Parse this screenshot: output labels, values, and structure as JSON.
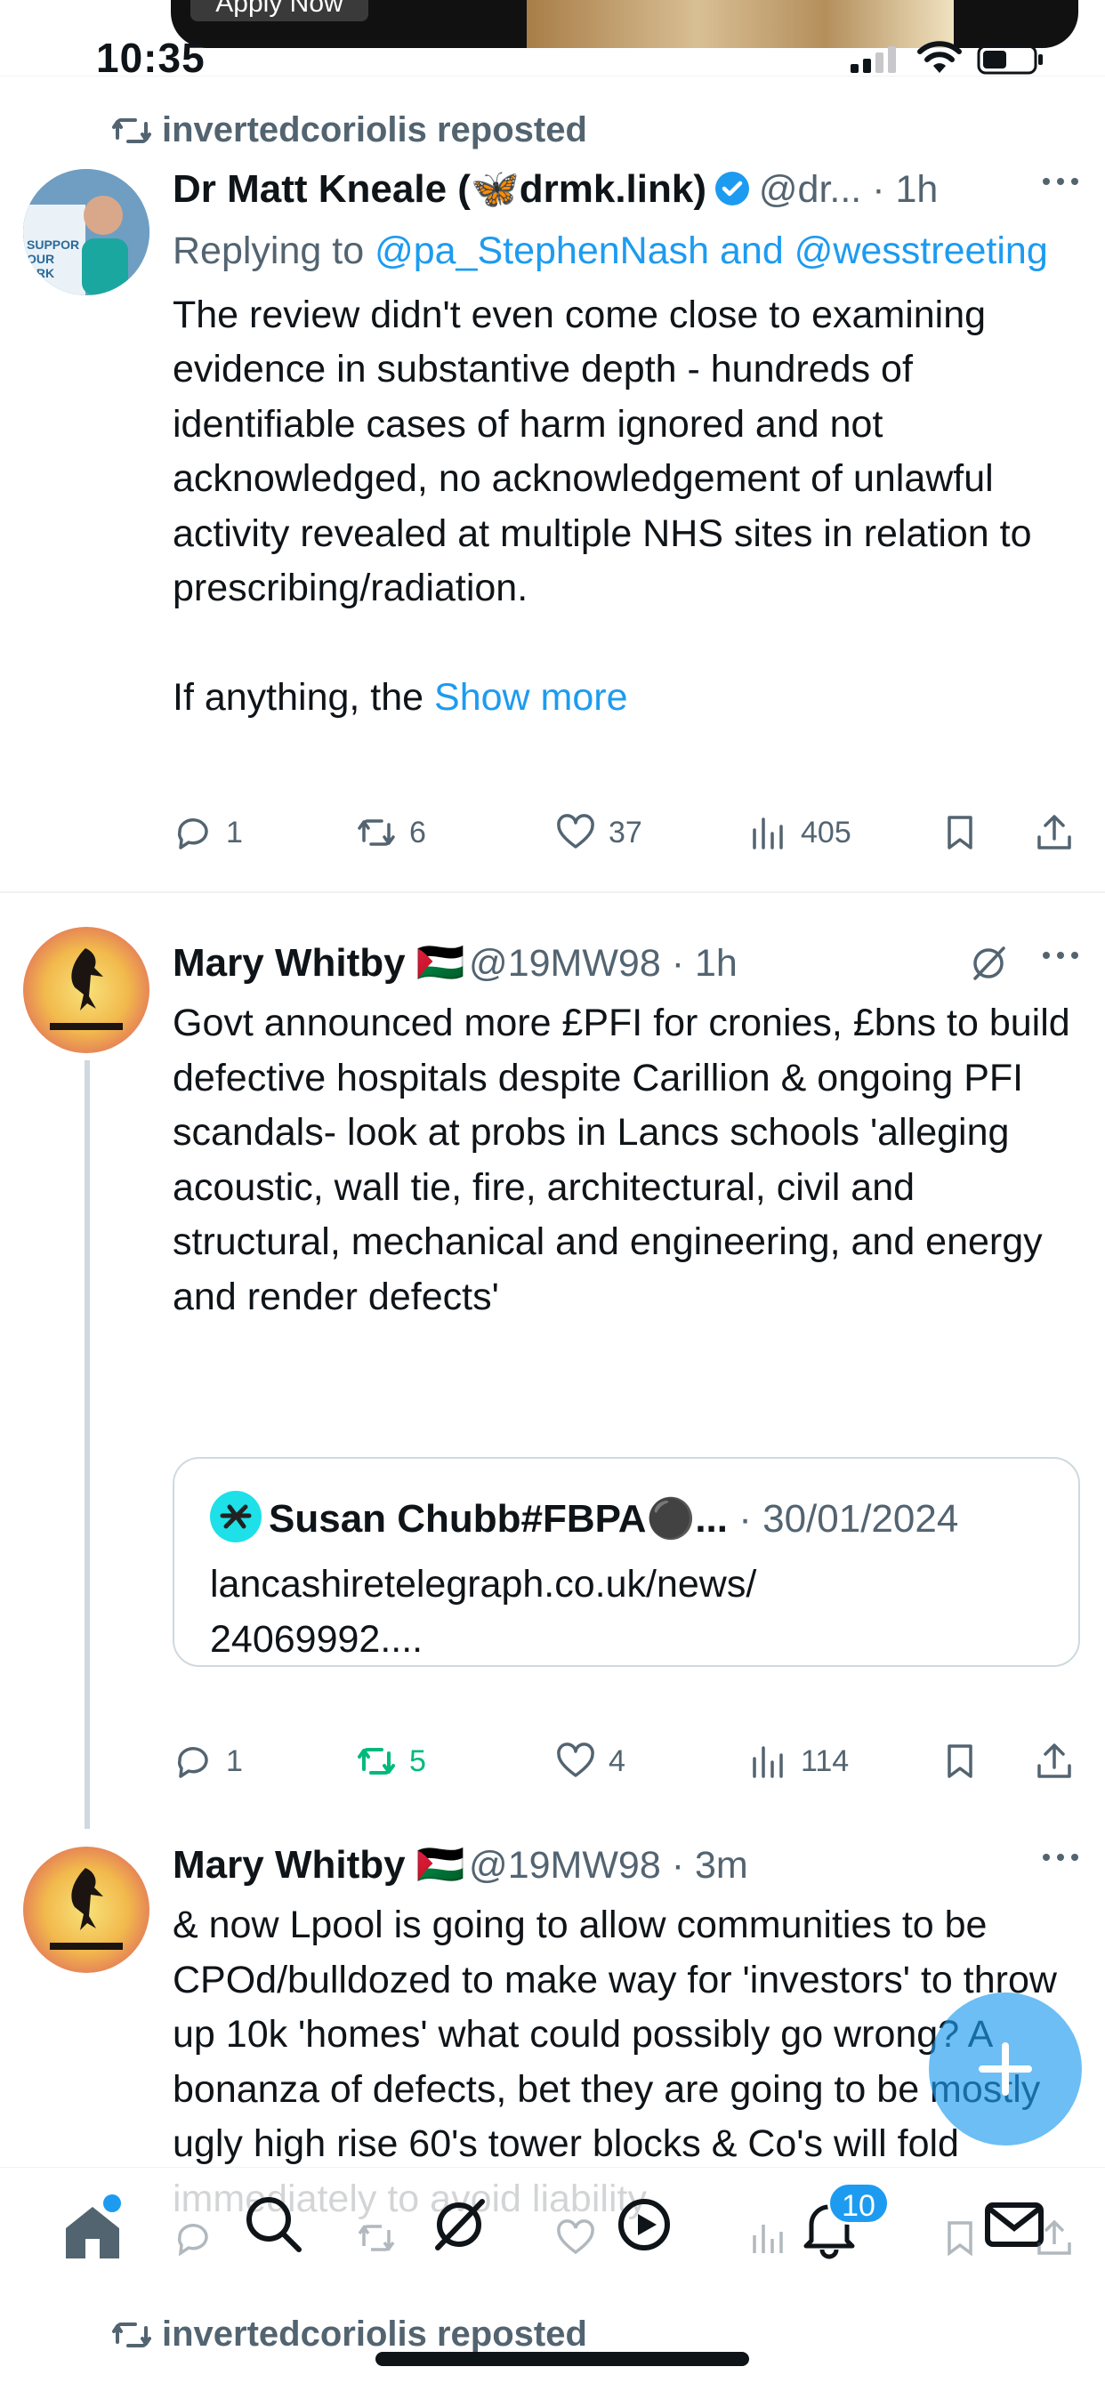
{
  "status_bar": {
    "time": "10:35",
    "ad_button": "Apply Now"
  },
  "tweets": [
    {
      "reposted_by": "invertedcoriolis reposted",
      "name": "Dr Matt Kneale (🦋drmk.link)",
      "handle": "@dr... · 1h",
      "replying_prefix": "Replying to ",
      "replying_to": "@pa_StephenNash and @wesstreeting",
      "body": "The review didn't even come close to examining evidence in substantive depth - hundreds of identifiable cases of harm ignored and not acknowledged, no acknowledgement of unlawful activity revealed at multiple NHS sites in relation to prescribing/radiation.",
      "body2": "If anything, the ",
      "show_more": "Show more",
      "replies": "1",
      "reposts": "6",
      "likes": "37",
      "views": "405"
    },
    {
      "name": "Mary Whitby 🇵🇸",
      "handle": "@19MW98 · 1h",
      "body": "Govt announced more £PFI for cronies, £bns to build defective hospitals despite Carillion & ongoing PFI scandals- look at probs in Lancs schools 'alleging acoustic, wall tie, fire, architectural, civil and structural, mechanical and engineering, and energy and render defects'",
      "quote": {
        "name": "Susan Chubb#FBPA⚫...",
        "date": " · 30/01/2024",
        "body": "lancashiretelegraph.co.uk/news/\n24069992...."
      },
      "replies": "1",
      "reposts": "5",
      "likes": "4",
      "views": "114"
    },
    {
      "name": "Mary Whitby 🇵🇸",
      "handle": "@19MW98 · 3m",
      "body": "& now Lpool is going to allow communities to be CPOd/bulldozed to make way for 'investors' to throw up 10k 'homes' what could possibly go wrong? A bonanza of defects, bet they are going to be mostly ugly high rise 60's tower blocks & Co's will fold immediately to avoid liability"
    }
  ],
  "next_reposted": "invertedcoriolis reposted",
  "nav": {
    "notifications_badge": "10"
  },
  "colors": {
    "accent": "#1d9bf0",
    "repost_active": "#00ba7c",
    "muted": "#536471"
  }
}
